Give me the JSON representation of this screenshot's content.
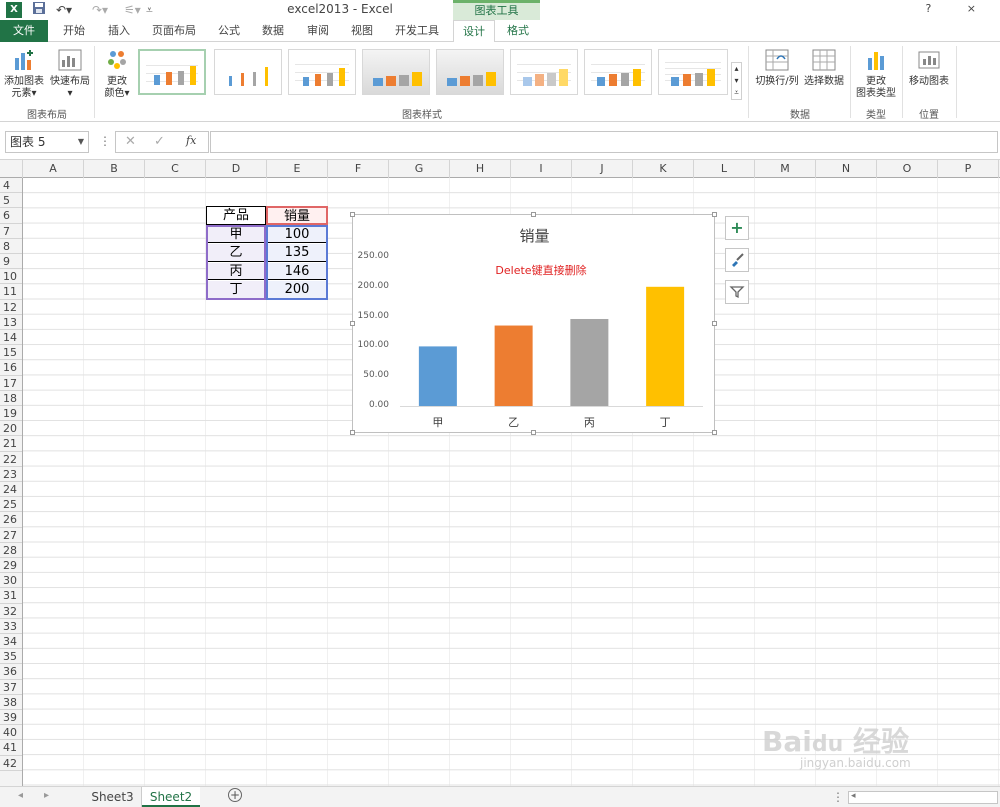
{
  "titlebar": {
    "title": "excel2013 - Excel",
    "context_tools": "图表工具",
    "help": "?"
  },
  "tabs": [
    "文件",
    "开始",
    "插入",
    "页面布局",
    "公式",
    "数据",
    "审阅",
    "视图",
    "开发工具",
    "设计",
    "格式"
  ],
  "ribbon": {
    "add_element": "添加图表\n元素",
    "add_element_line1": "添加图表",
    "add_element_line2": "元素",
    "quick_layout": "快速布局",
    "change_color_line1": "更改",
    "change_color_line2": "颜色",
    "group_layout": "图表布局",
    "group_styles": "图表样式",
    "switch_rowcol": "切换行/列",
    "select_data": "选择数据",
    "group_data": "数据",
    "change_type_line1": "更改",
    "change_type_line2": "图表类型",
    "group_type": "类型",
    "move_chart": "移动图表",
    "group_location": "位置"
  },
  "formula_bar": {
    "name_box": "图表 5",
    "cancel": "✕",
    "enter": "✓",
    "fx": "fx",
    "value": ""
  },
  "columns": [
    "A",
    "B",
    "C",
    "D",
    "E",
    "F",
    "G",
    "H",
    "I",
    "J",
    "K",
    "L",
    "M",
    "N",
    "O",
    "P"
  ],
  "rows": [
    "4",
    "5",
    "6",
    "7",
    "8",
    "9",
    "10",
    "11",
    "12",
    "13",
    "14",
    "15",
    "16",
    "17",
    "18",
    "19",
    "20",
    "21",
    "22",
    "23",
    "24",
    "25",
    "26",
    "27",
    "28",
    "29",
    "30",
    "31",
    "32",
    "33",
    "34",
    "35",
    "36",
    "37",
    "38",
    "39",
    "40",
    "41",
    "42"
  ],
  "table": {
    "header_product": "产品",
    "header_sales": "销量",
    "rows": [
      {
        "product": "甲",
        "sales": "100"
      },
      {
        "product": "乙",
        "sales": "135"
      },
      {
        "product": "丙",
        "sales": "146"
      },
      {
        "product": "丁",
        "sales": "200"
      }
    ]
  },
  "chart_data": {
    "type": "bar",
    "title": "销量",
    "annotation": "Delete键直接删除",
    "categories": [
      "甲",
      "乙",
      "丙",
      "丁"
    ],
    "values": [
      100,
      135,
      146,
      200
    ],
    "colors": [
      "#5b9bd5",
      "#ed7d31",
      "#a5a5a5",
      "#ffc000"
    ],
    "ylim": [
      0,
      250
    ],
    "yticks": [
      "250.00",
      "200.00",
      "150.00",
      "100.00",
      "50.00",
      "0.00"
    ],
    "grid": false,
    "legend": "none"
  },
  "sheets": [
    "Sheet3",
    "Sheet2"
  ],
  "active_sheet": "Sheet2",
  "watermark": "Baidu 经验 jingyan.baidu.com"
}
